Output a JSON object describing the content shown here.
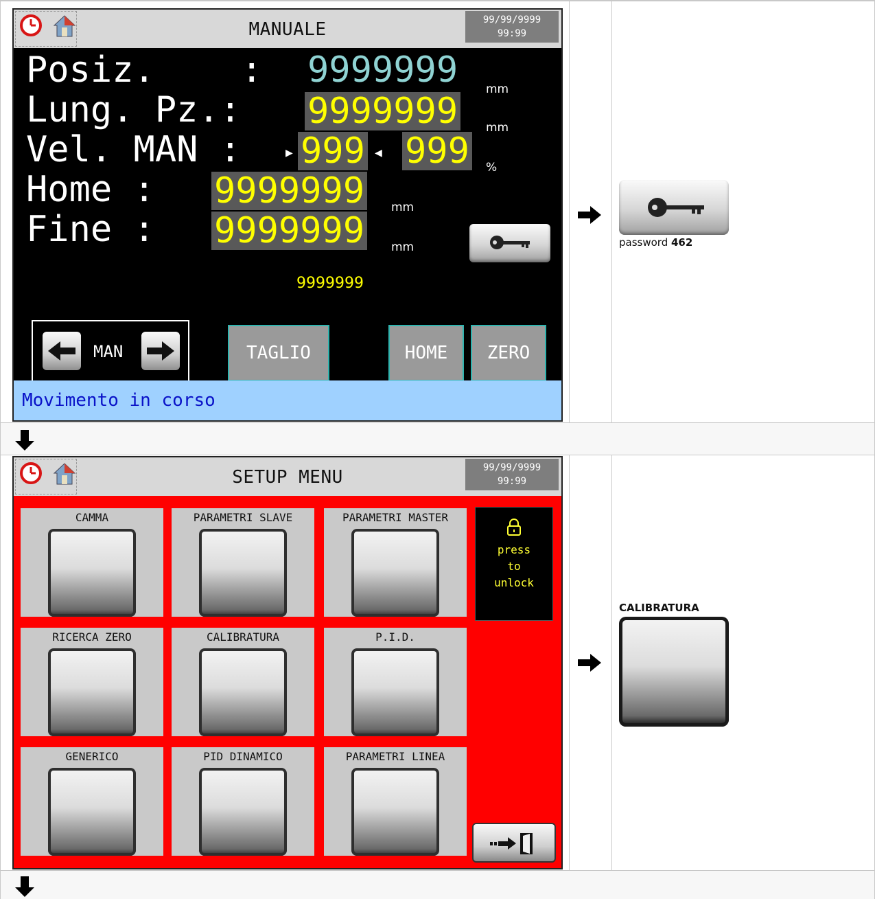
{
  "screen_manual": {
    "title": "MANUALE",
    "datetime_date": "99/99/9999",
    "datetime_time": "99:99",
    "rows": {
      "posiz_label": "Posiz.    :",
      "posiz_value": "9999999",
      "posiz_unit": "mm",
      "lung_label": "Lung. Pz.:",
      "lung_value": "9999999",
      "lung_unit": "mm",
      "vel_label": "Vel. MAN :",
      "vel_value_1": "999",
      "vel_value_2": "999",
      "vel_unit": "%",
      "home_label": "Home :",
      "home_value": "9999999",
      "home_unit": "mm",
      "fine_label": "Fine :",
      "fine_value": "9999999",
      "fine_unit": "mm"
    },
    "counter": "9999999",
    "man_label": "MAN",
    "buttons": {
      "taglio": "TAGLIO",
      "home": "HOME",
      "zero": "ZERO"
    },
    "status": "Movimento in corso"
  },
  "password_note": {
    "prefix": "password ",
    "code": "462"
  },
  "screen_setup": {
    "title": "SETUP MENU",
    "datetime_date": "99/99/9999",
    "datetime_time": "99:99",
    "tiles": [
      "CAMMA",
      "PARAMETRI SLAVE",
      "PARAMETRI MASTER",
      "RICERCA ZERO",
      "CALIBRATURA",
      "P.I.D.",
      "GENERICO",
      "PID DINAMICO",
      "PARAMETRI LINEA"
    ],
    "lock": {
      "line1": "press",
      "line2": "to",
      "line3": "unlock"
    }
  },
  "calibratura_note": "CALIBRATURA",
  "colors": {
    "screen_bg": "#000000",
    "value_yellow": "#ffff00",
    "value_cyan": "#8fd3d3",
    "status_bar": "#9fd1ff",
    "status_text": "#0a12c8",
    "setup_bg": "#ff0000"
  }
}
